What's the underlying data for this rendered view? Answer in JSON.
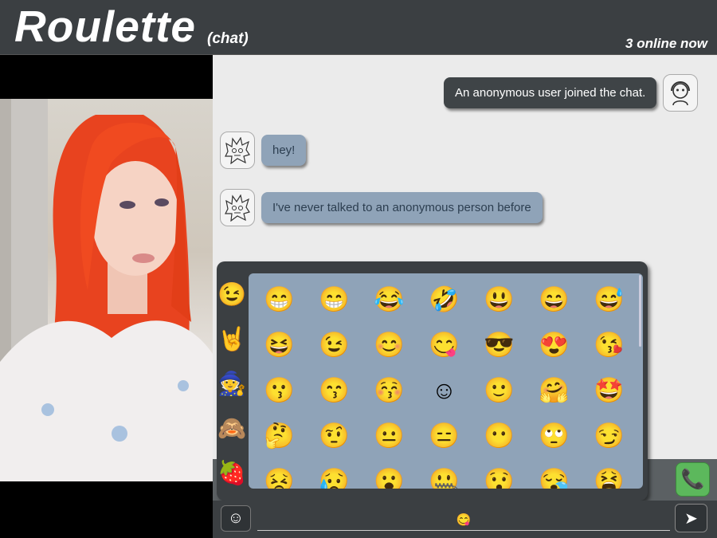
{
  "header": {
    "logo_text": "Roulette",
    "logo_sub": "(chat)",
    "online_status": "3 online now"
  },
  "messages": [
    {
      "sender": "system",
      "text": "An anonymous user joined the chat.",
      "avatar_icon": "anonymous-user-icon"
    },
    {
      "sender": "peer",
      "text": "hey!",
      "avatar_icon": "sketch-face-icon"
    },
    {
      "sender": "peer",
      "text": "I've never talked to an anonymous person before",
      "avatar_icon": "sketch-face-icon"
    }
  ],
  "emoji_picker": {
    "categories": [
      {
        "name": "smileys",
        "glyph": "😉"
      },
      {
        "name": "people",
        "glyph": "🤘"
      },
      {
        "name": "fantasy",
        "glyph": "🧙"
      },
      {
        "name": "animals",
        "glyph": "🙈"
      },
      {
        "name": "food",
        "glyph": "🍓"
      }
    ],
    "emojis": [
      "😁",
      "😁",
      "😂",
      "🤣",
      "😃",
      "😄",
      "😅",
      "😆",
      "😉",
      "😊",
      "😋",
      "😎",
      "😍",
      "😘",
      "😗",
      "😙",
      "😚",
      "☺",
      "🙂",
      "🤗",
      "🤩",
      "🤔",
      "🤨",
      "😐",
      "😑",
      "😶",
      "🙄",
      "😏",
      "😣",
      "😥",
      "😮",
      "🤐",
      "😯",
      "😪",
      "😫"
    ]
  },
  "input": {
    "emoji_button": "☺",
    "placeholder": "",
    "value": "😋",
    "send_button": "➤"
  },
  "call_button": "📞",
  "colors": {
    "header_bg": "#3b3f42",
    "bubble_peer": "#8fa3b8",
    "bubble_system": "#3f4447",
    "call_green": "#5cb85c"
  }
}
